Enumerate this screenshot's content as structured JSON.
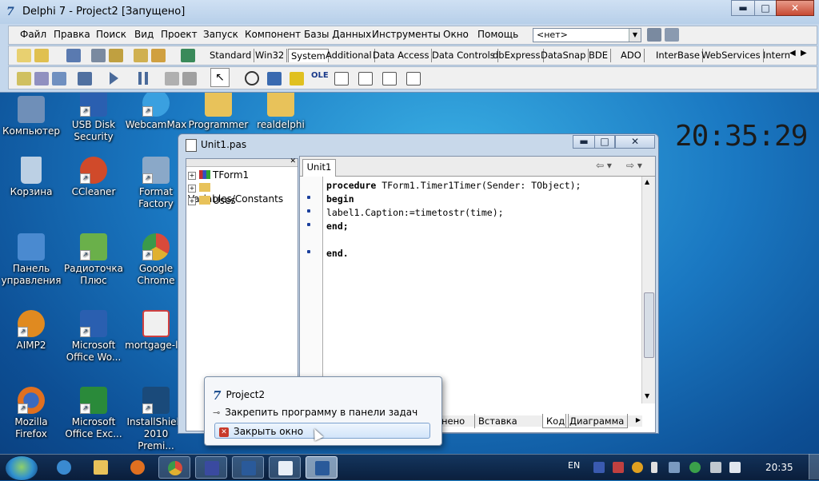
{
  "delphi": {
    "title": "Delphi 7 - Project2 [Запущено]",
    "window_buttons": {
      "minimize": "▬",
      "maximize": "□",
      "close": "✕"
    },
    "menu": [
      "Файл",
      "Правка",
      "Поиск",
      "Вид",
      "Проект",
      "Запуск",
      "Компонент",
      "Базы Данных",
      "Инструменты",
      "Окно",
      "Помощь"
    ],
    "combo_value": "<нет>",
    "palette_tabs": [
      "Standard",
      "Win32",
      "System",
      "Additional",
      "Data Access",
      "Data Controls",
      "dbExpress",
      "DataSnap",
      "BDE",
      "ADO",
      "InterBase",
      "WebServices",
      "Intern"
    ],
    "palette_active": "System",
    "ole_label": "OLE"
  },
  "desktop": {
    "icons": [
      {
        "label": "Компьютер",
        "color": "#6f8fb8"
      },
      {
        "label": "USB Disk Security",
        "color": "#2a5fb0"
      },
      {
        "label": "WebcamMax",
        "color": "#3aa0e0"
      },
      {
        "label": "Programmer",
        "color": "#e8c25a"
      },
      {
        "label": "realdelphi",
        "color": "#e8c25a"
      },
      {
        "label": "Корзина",
        "color": "#bcd0e4"
      },
      {
        "label": "CCleaner",
        "color": "#d04a2a"
      },
      {
        "label": "Format Factory",
        "color": "#8aa8c8"
      },
      {
        "label": "Панель управления",
        "color": "#4a8ad0"
      },
      {
        "label": "Радиоточка Плюс",
        "color": "#6ab04a"
      },
      {
        "label": "Google Chrome",
        "color": "#e0b030"
      },
      {
        "label": "AIMP2",
        "color": "#e08a20"
      },
      {
        "label": "Microsoft Office Wo...",
        "color": "#2a5fb0"
      },
      {
        "label": "mortgage-l...",
        "color": "#d04040"
      },
      {
        "label": "Mozilla Firefox",
        "color": "#e07020"
      },
      {
        "label": "Microsoft Office Exc...",
        "color": "#2a8a3a"
      },
      {
        "label": "InstallShield 2010 Premi...",
        "color": "#1a4a7a"
      }
    ],
    "big_clock": "20:35:29"
  },
  "editor": {
    "title": "Unit1.pas",
    "tree": [
      "TForm1",
      "Variables/Constants",
      "Uses"
    ],
    "tab": "Unit1",
    "code_lines": [
      {
        "kw": "procedure",
        "rest": " TForm1.Timer1Timer(Sender: TObject);"
      },
      {
        "kw": "begin",
        "rest": ""
      },
      {
        "kw": "",
        "rest": "label1.Caption:=timetostr(time);"
      },
      {
        "kw": "end;",
        "rest": ""
      },
      {
        "kw": "",
        "rest": ""
      },
      {
        "kw": "end.",
        "rest": ""
      }
    ],
    "bottom_tabs": [
      "нено",
      "Вставка",
      "Код",
      "Диаграмма"
    ]
  },
  "jumplist": {
    "app": "Project2",
    "pin": "Закрепить программу в панели задач",
    "close": "Закрыть окно"
  },
  "taskbar": {
    "language": "EN",
    "time": "20:35"
  }
}
